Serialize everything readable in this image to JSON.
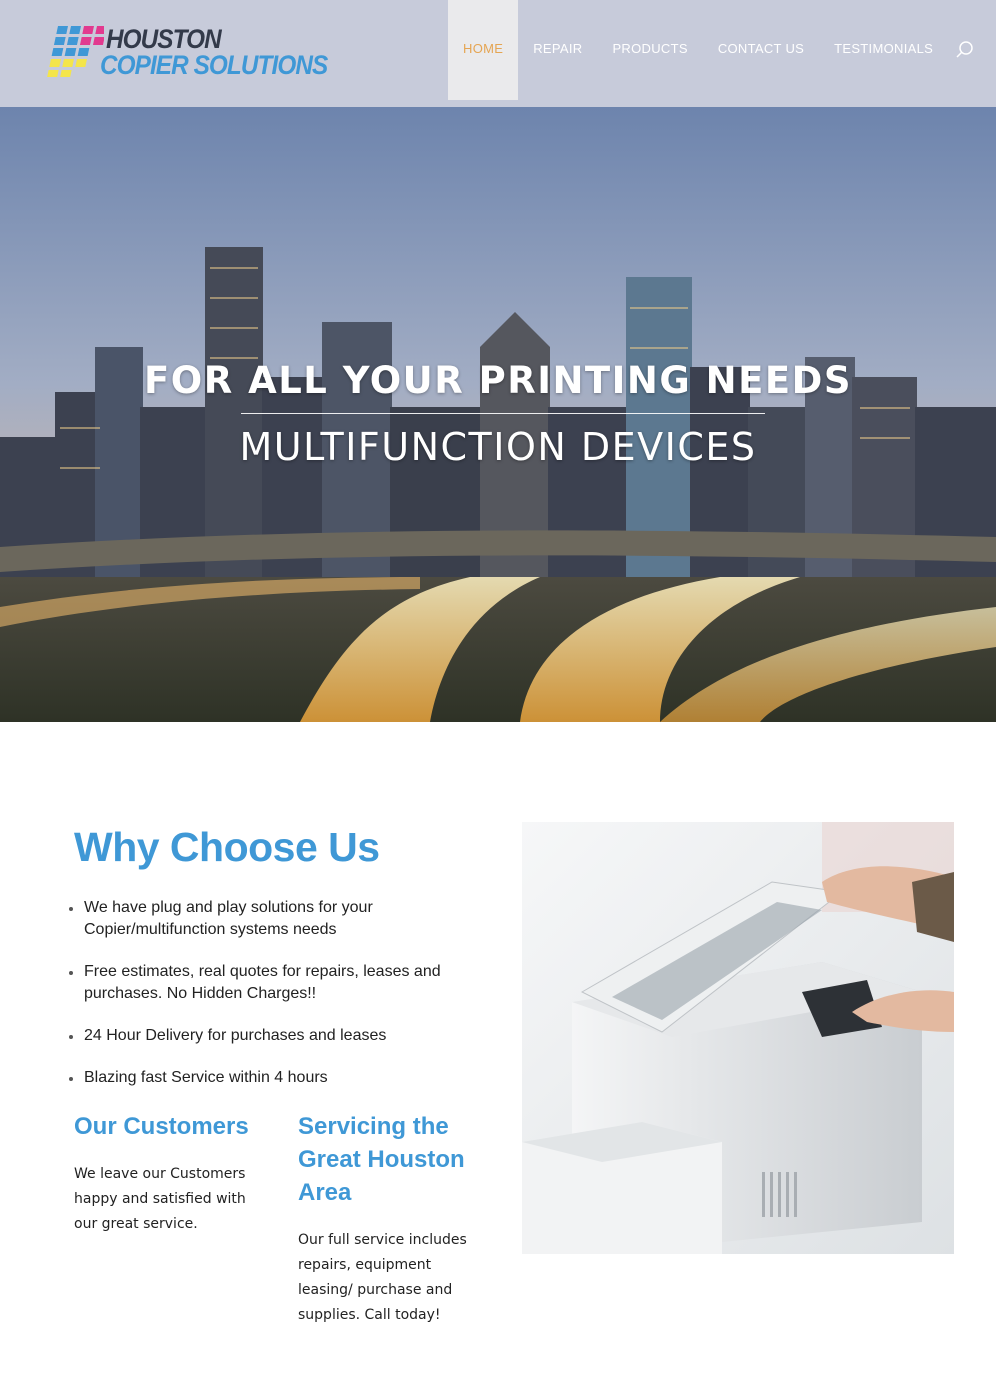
{
  "header": {
    "logo": {
      "line1": "HOUSTON",
      "line2": "COPIER SOLUTIONS"
    },
    "nav": [
      {
        "label": "HOME",
        "active": true
      },
      {
        "label": "REPAIR",
        "active": false
      },
      {
        "label": "PRODUCTS",
        "active": false
      },
      {
        "label": "CONTACT US",
        "active": false
      },
      {
        "label": "TESTIMONIALS",
        "active": false
      }
    ],
    "search_icon": "search-icon"
  },
  "hero": {
    "title": "FOR ALL YOUR PRINTING NEEDS",
    "subtitle": "MULTIFUNCTION DEVICES"
  },
  "why": {
    "title": "Why Choose Us",
    "bullets": [
      "We have plug and play solutions for your Copier/multifunction systems needs",
      "Free estimates, real quotes for repairs, leases and purchases. No Hidden Charges!!",
      "24 Hour Delivery for purchases and leases",
      "Blazing fast Service within 4 hours"
    ]
  },
  "customers": {
    "title": "Our Customers",
    "text": "We leave our Customers happy and satisfied with our great service."
  },
  "servicing": {
    "title": "Servicing the Great Houston Area",
    "text": "Our full service includes repairs, equipment leasing/ purchase and supplies. Call today!"
  },
  "colors": {
    "accent_blue": "#3f98d6",
    "nav_active": "#e5a553",
    "header_bg": "#c7cbda"
  }
}
